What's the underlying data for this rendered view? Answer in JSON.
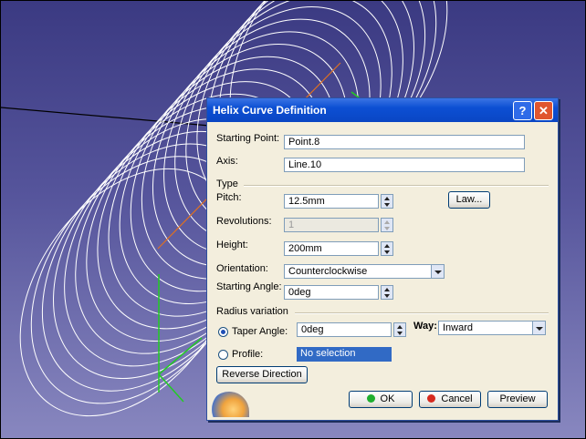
{
  "dialog": {
    "title": "Helix Curve Definition",
    "help_glyph": "?",
    "close_glyph": "✕",
    "starting_point": {
      "label": "Starting Point:",
      "value": "Point.8"
    },
    "axis": {
      "label": "Axis:",
      "value": "Line.10"
    },
    "type_group": "Type",
    "pitch": {
      "label": "Pitch:",
      "value": "12.5mm"
    },
    "law_button": "Law...",
    "revolutions": {
      "label": "Revolutions:",
      "value": "1"
    },
    "height": {
      "label": "Height:",
      "value": "200mm"
    },
    "orientation": {
      "label": "Orientation:",
      "value": "Counterclockwise"
    },
    "starting_angle": {
      "label": "Starting Angle:",
      "value": "0deg"
    },
    "radius_group": "Radius variation",
    "taper_angle": {
      "label": "Taper Angle:",
      "value": "0deg",
      "selected": true
    },
    "way": {
      "label": "Way:",
      "value": "Inward"
    },
    "profile": {
      "label": "Profile:",
      "value": "No selection",
      "selected": false
    },
    "reverse_button": "Reverse Direction",
    "ok_button": "OK",
    "cancel_button": "Cancel",
    "preview_button": "Preview"
  },
  "viewport": {
    "helix_color": "#ffffff",
    "axis_color": "#e07020",
    "compass_color": "#22cc22"
  }
}
